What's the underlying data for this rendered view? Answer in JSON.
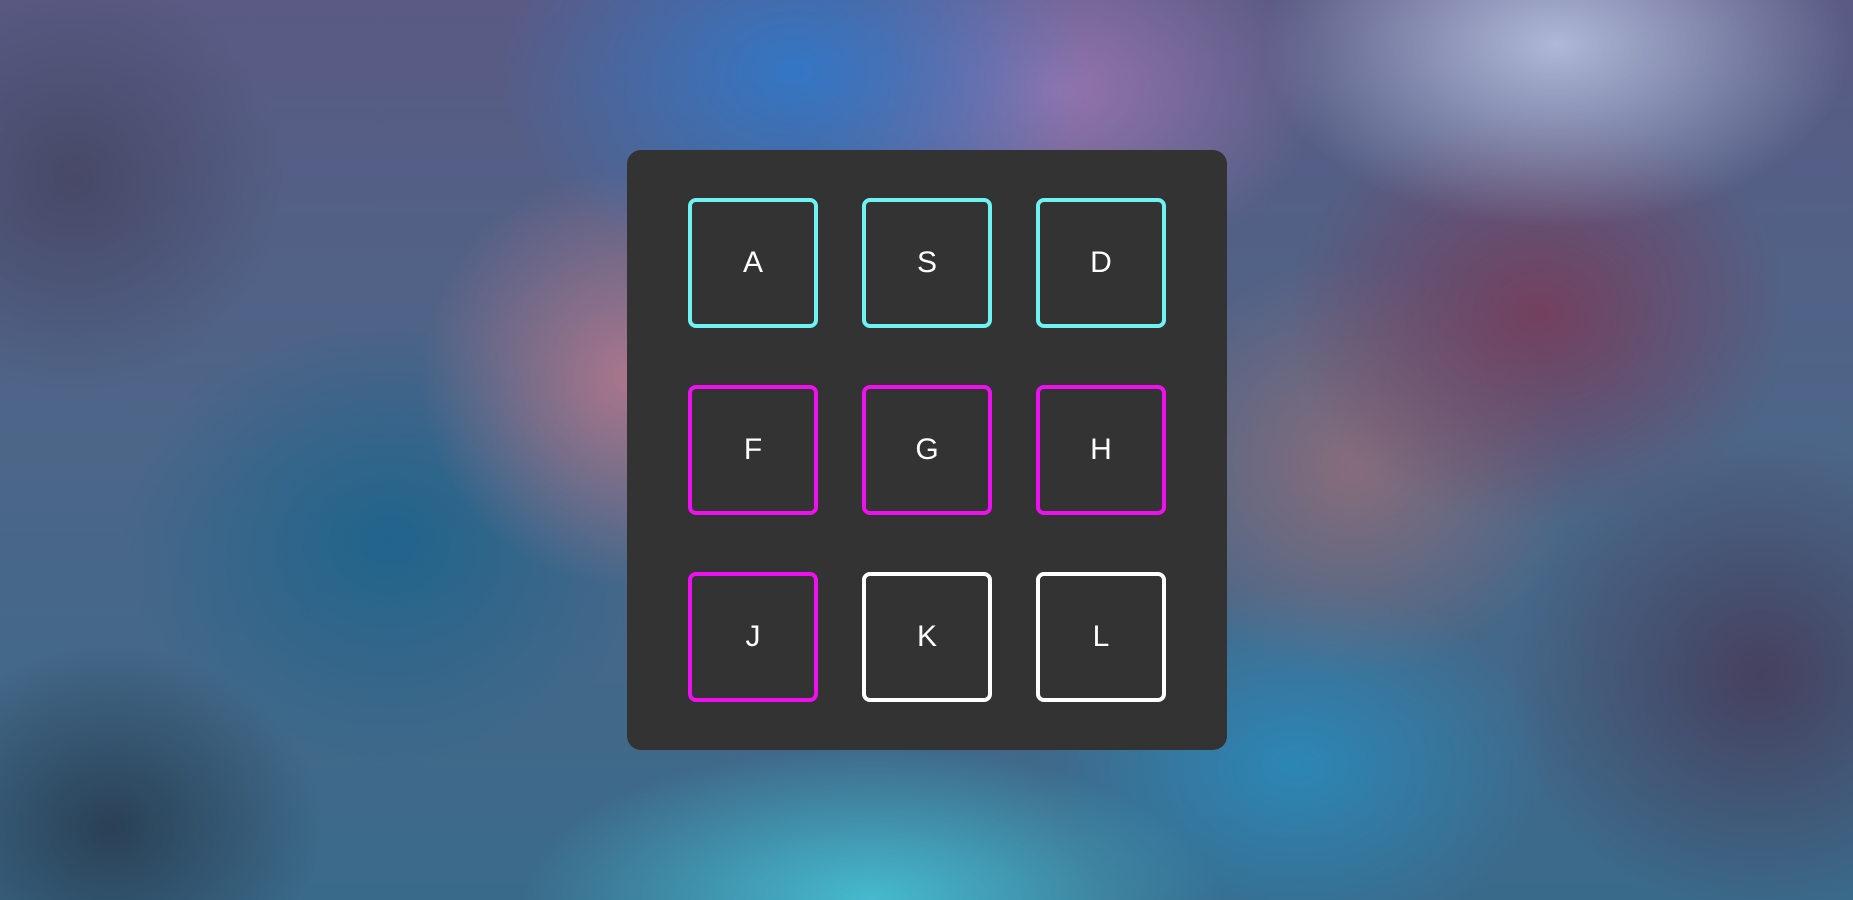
{
  "keypad": {
    "keys": [
      {
        "label": "A",
        "border_color": "#6ef2f2"
      },
      {
        "label": "S",
        "border_color": "#6ef2f2"
      },
      {
        "label": "D",
        "border_color": "#6ef2f2"
      },
      {
        "label": "F",
        "border_color": "#ee10ee"
      },
      {
        "label": "G",
        "border_color": "#ee10ee"
      },
      {
        "label": "H",
        "border_color": "#ee10ee"
      },
      {
        "label": "J",
        "border_color": "#ee10ee"
      },
      {
        "label": "K",
        "border_color": "#ffffff"
      },
      {
        "label": "L",
        "border_color": "#ffffff"
      }
    ]
  },
  "colors": {
    "panel_background": "#333333",
    "cyan_accent": "#6ef2f2",
    "magenta_accent": "#ee10ee",
    "white_accent": "#ffffff"
  }
}
